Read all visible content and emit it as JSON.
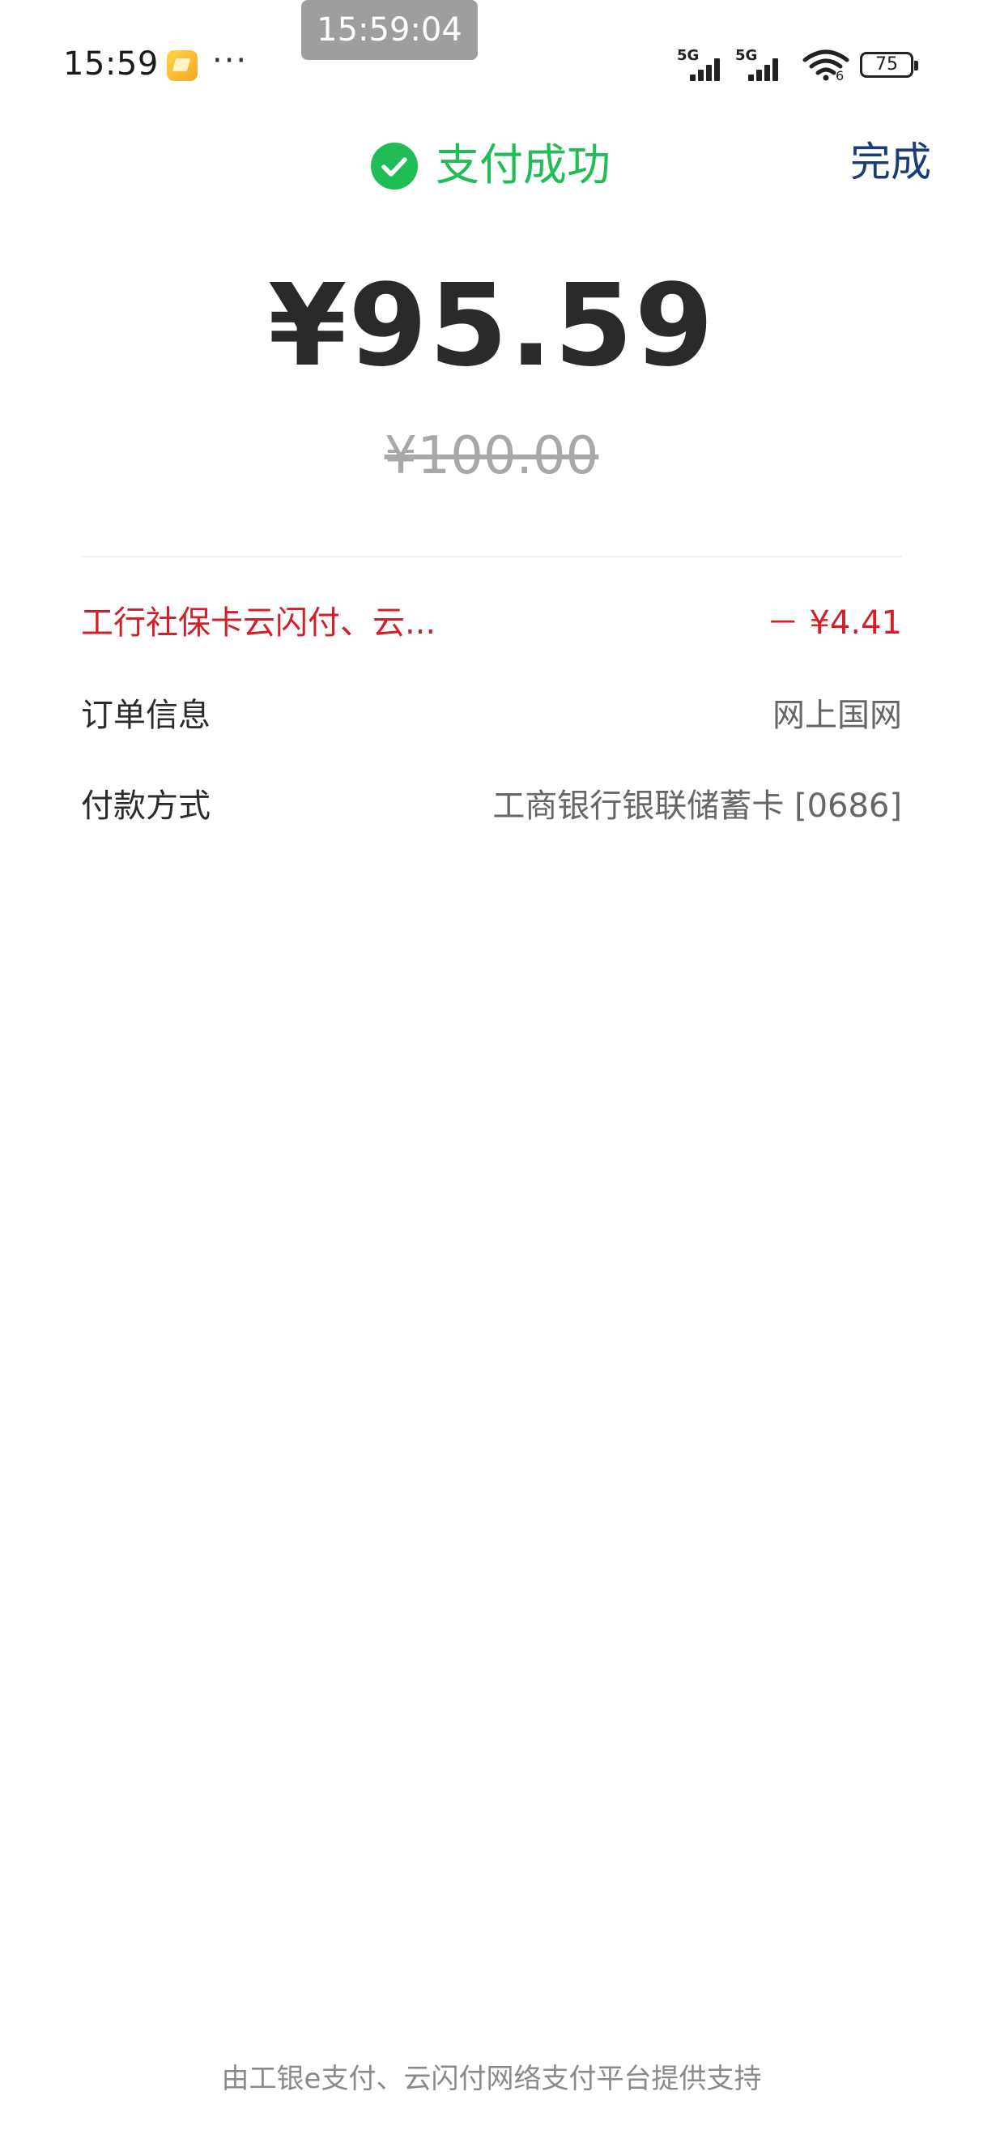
{
  "status_bar": {
    "time": "15:59",
    "app_icon": "notes-app-icon",
    "more": "···",
    "net1": "5G",
    "net2": "5G",
    "wifi_sub": "6",
    "battery": "75"
  },
  "timestamp_overlay": "15:59:04",
  "header": {
    "title": "支付成功",
    "done_label": "完成",
    "success_color": "#20bc55",
    "done_color": "#1a3d7a"
  },
  "payment": {
    "amount": "¥95.59",
    "original_amount": "¥100.00"
  },
  "details": [
    {
      "label": "工行社保卡云闪付、云...",
      "value": "－ ¥4.41",
      "kind": "discount"
    },
    {
      "label": "订单信息",
      "value": "网上国网",
      "kind": "normal"
    },
    {
      "label": "付款方式",
      "value": "工商银行银联储蓄卡 [0686]",
      "kind": "normal"
    }
  ],
  "footer": "由工银e支付、云闪付网络支付平台提供支持",
  "colors": {
    "discount": "#d0202a",
    "amount": "#2a2a2a",
    "muted": "#a8a8a8"
  }
}
